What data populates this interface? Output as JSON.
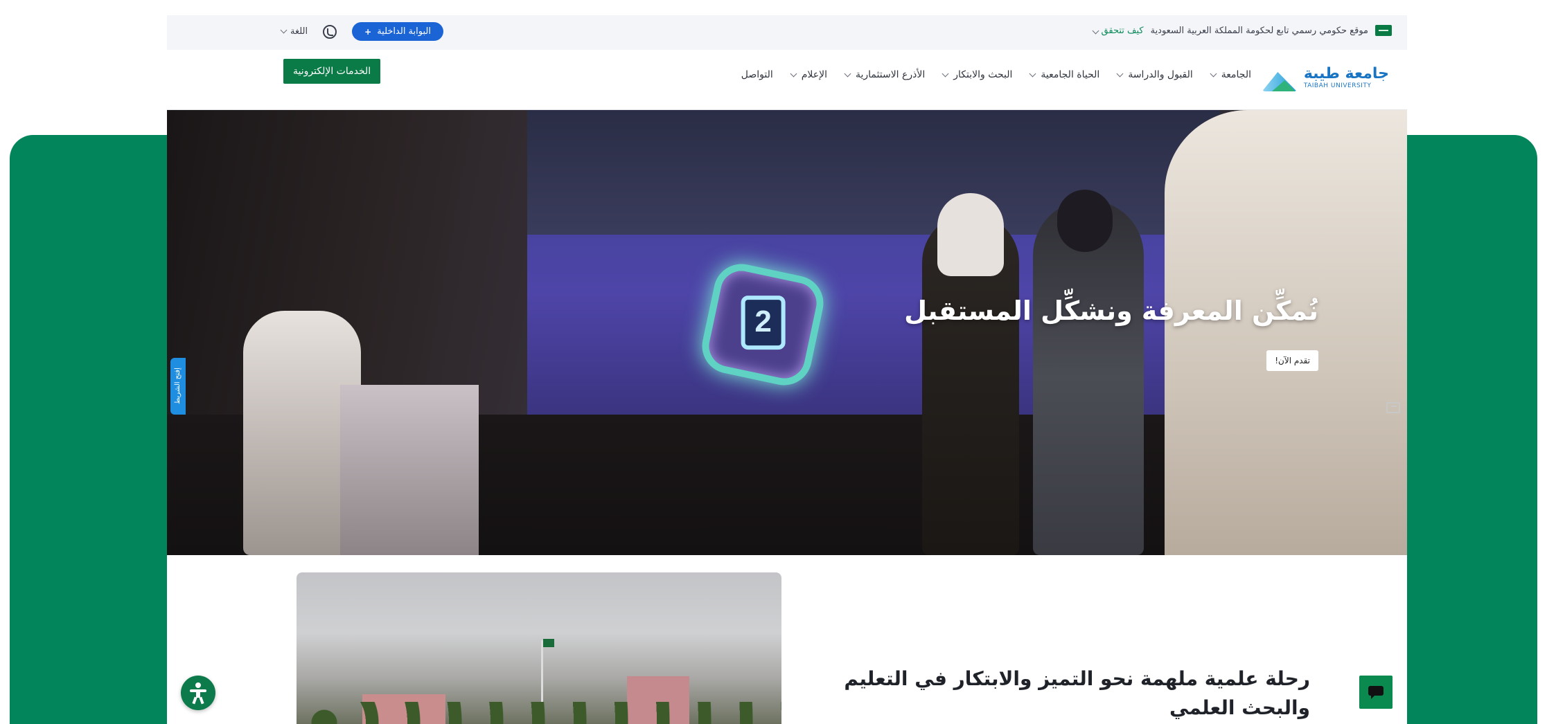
{
  "colors": {
    "frame": "#03855b",
    "primary_green": "#0a7a46",
    "portal_blue": "#1b64d6"
  },
  "govbar": {
    "note": "موقع حكومي رسمي تابع لحكومة المملكة العربية السعودية",
    "verify": "كيف تتحقق",
    "portal": "البوابة الداخلية",
    "language": "اللغة"
  },
  "nav": {
    "logo_ar": "جامعة طيبة",
    "logo_en": "TAIBAH UNIVERSITY",
    "items": [
      "الجامعة",
      "القبول والدراسة",
      "الحياة الجامعية",
      "البحث والابتكار",
      "الأذرع الاستثمارية",
      "الإعلام",
      "التواصل"
    ],
    "eservices": "الخدمات الإلكترونية"
  },
  "hero": {
    "title": "نُمكِّن المعرفة ونشكِّل المستقبل",
    "apply": "تقدم الآن!",
    "badge_number": "2",
    "side_tab": "إفتح الشريط"
  },
  "about": {
    "title_line1": "رحلة علمية ملهمة نحو التميز والابتكار في التعليم",
    "title_line2": "والبحث العلمي"
  },
  "icons": [
    "flag-icon",
    "phone-icon",
    "chevron-down-icon",
    "plus-icon",
    "gallery-icon",
    "accessibility-icon",
    "chat-icon"
  ]
}
